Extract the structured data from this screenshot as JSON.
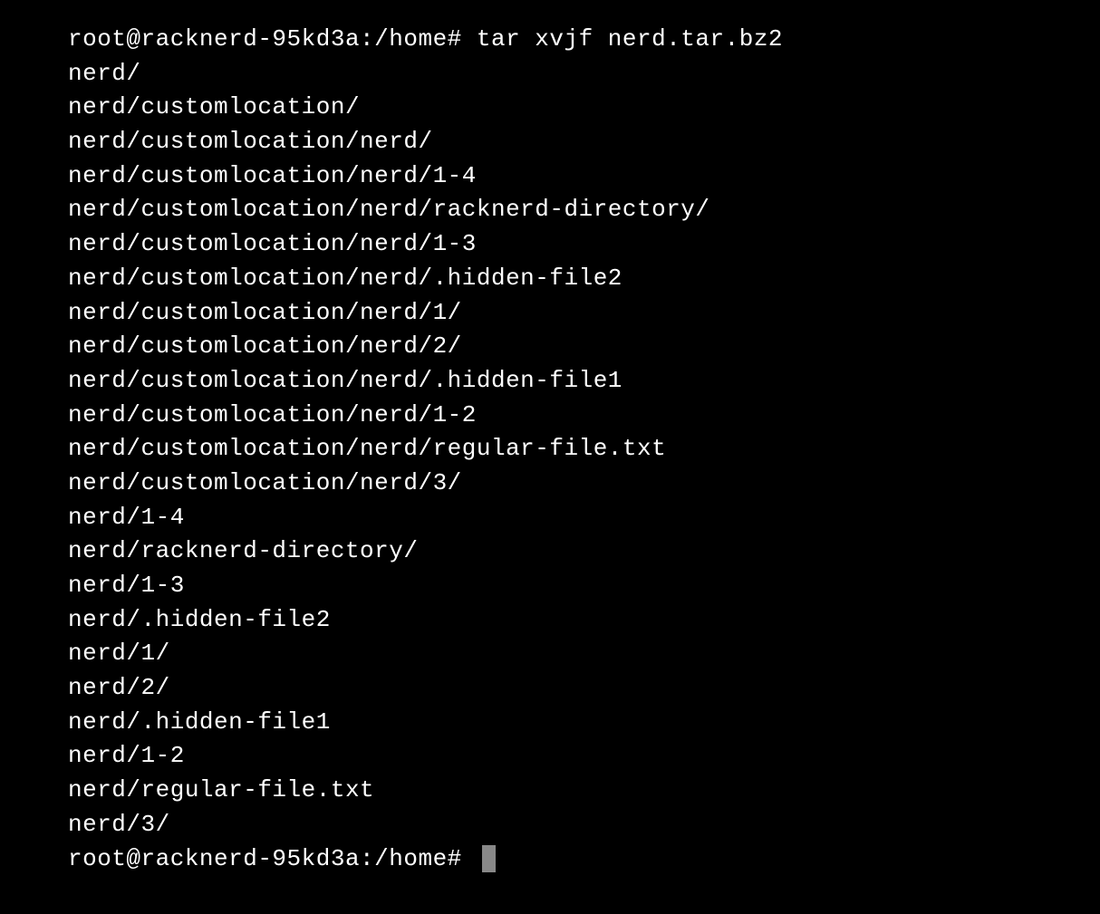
{
  "terminal": {
    "prompt1": "root@racknerd-95kd3a:/home# ",
    "command": "tar xvjf nerd.tar.bz2",
    "output_lines": [
      "nerd/",
      "nerd/customlocation/",
      "nerd/customlocation/nerd/",
      "nerd/customlocation/nerd/1-4",
      "nerd/customlocation/nerd/racknerd-directory/",
      "nerd/customlocation/nerd/1-3",
      "nerd/customlocation/nerd/.hidden-file2",
      "nerd/customlocation/nerd/1/",
      "nerd/customlocation/nerd/2/",
      "nerd/customlocation/nerd/.hidden-file1",
      "nerd/customlocation/nerd/1-2",
      "nerd/customlocation/nerd/regular-file.txt",
      "nerd/customlocation/nerd/3/",
      "nerd/1-4",
      "nerd/racknerd-directory/",
      "nerd/1-3",
      "nerd/.hidden-file2",
      "nerd/1/",
      "nerd/2/",
      "nerd/.hidden-file1",
      "nerd/1-2",
      "nerd/regular-file.txt",
      "nerd/3/"
    ],
    "prompt2": "root@racknerd-95kd3a:/home# "
  }
}
